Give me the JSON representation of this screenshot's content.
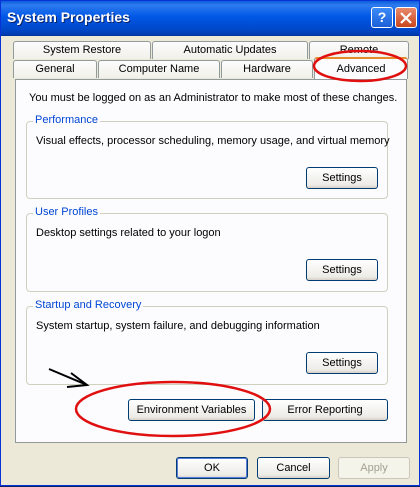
{
  "window": {
    "title": "System Properties",
    "help_label": "?",
    "close_icon": "close-icon"
  },
  "tabs": {
    "top_row": [
      "System Restore",
      "Automatic Updates",
      "Remote"
    ],
    "bottom_row": [
      "General",
      "Computer Name",
      "Hardware",
      "Advanced"
    ],
    "active": "Advanced"
  },
  "advanced": {
    "notice": "You must be logged on as an Administrator to make most of these changes.",
    "performance": {
      "title": "Performance",
      "description": "Visual effects, processor scheduling, memory usage, and virtual memory",
      "button": "Settings"
    },
    "user_profiles": {
      "title": "User Profiles",
      "description": "Desktop settings related to your logon",
      "button": "Settings"
    },
    "startup_recovery": {
      "title": "Startup and Recovery",
      "description": "System startup, system failure, and debugging information",
      "button": "Settings"
    },
    "env_button": "Environment Variables",
    "error_button": "Error Reporting"
  },
  "footer": {
    "ok": "OK",
    "cancel": "Cancel",
    "apply": "Apply"
  },
  "colors": {
    "titlebar": "#0058e6",
    "group_title": "#0046d5",
    "annotation": "#e01010"
  }
}
